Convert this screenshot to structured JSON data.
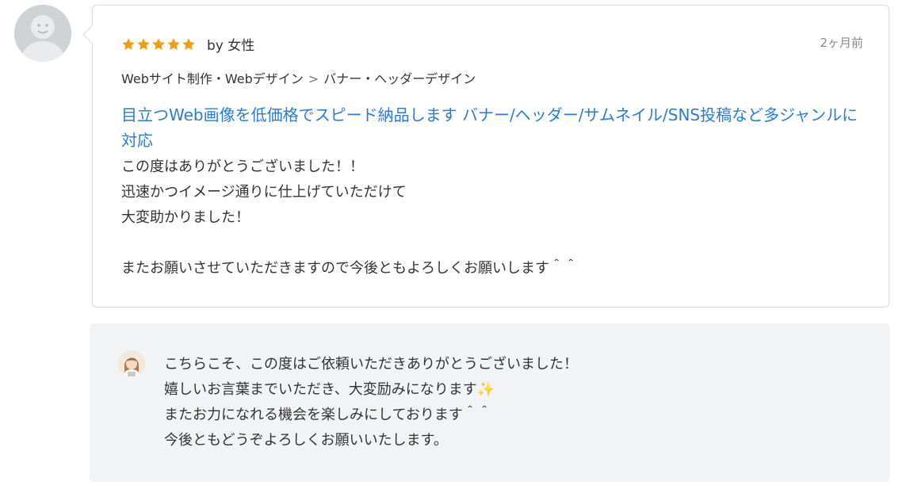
{
  "review": {
    "rating": 5,
    "rating_max": 5,
    "star_color": "#f39c12",
    "by_label": "by 女性",
    "date": "2ヶ月前",
    "category": {
      "parent": "Webサイト制作・Webデザイン",
      "separator": ">",
      "child": "バナー・ヘッダーデザイン"
    },
    "service_title": "目立つWeb画像を低価格でスピード納品します バナー/ヘッダー/サムネイル/SNS投稿など多ジャンルに対応",
    "body_lines": [
      "この度はありがとうございました！！",
      "迅速かつイメージ通りに仕上げていただけて",
      "大変助かりました！",
      "",
      "またお願いさせていただきますので今後ともよろしくお願いします＾＾"
    ]
  },
  "reply": {
    "lines": [
      "こちらこそ、この度はご依頼いただきありがとうございました！",
      "嬉しいお言葉までいただき、大変励みになります✨",
      "またお力になれる機会を楽しみにしております＾＾",
      "今後ともどうぞよろしくお願いいたします。"
    ]
  },
  "colors": {
    "link": "#2a7bd8",
    "text": "#333333",
    "muted": "#888888",
    "reply_bg": "#f2f3f5",
    "avatar_bg": "#d0d3d6"
  },
  "icons": {
    "reviewer_avatar": "default-user-avatar-icon",
    "star": "star-icon",
    "seller_avatar": "seller-avatar"
  }
}
